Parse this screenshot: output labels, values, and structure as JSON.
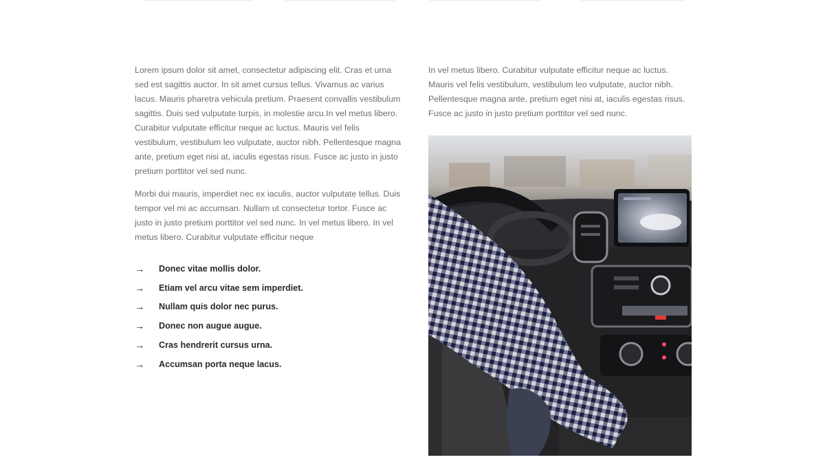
{
  "content": {
    "left": {
      "paragraphs": [
        "Lorem ipsum dolor sit amet, consectetur adipiscing elit. Cras et urna sed est sagittis auctor. In sit amet cursus tellus. Vivamus ac varius lacus. Mauris pharetra vehicula pretium. Praesent convallis vestibulum sagittis. Duis sed vulputate turpis, in molestie arcu.In vel metus libero. Curabitur vulputate efficitur neque ac luctus. Mauris vel felis vestibulum, vestibulum leo vulputate, auctor nibh. Pellentesque magna ante, pretium eget nisi at, iaculis egestas risus. Fusce ac justo in justo pretium porttitor vel sed nunc.",
        "Morbi dui mauris, imperdiet nec ex iaculis, auctor vulputate tellus. Duis tempor vel mi ac accumsan. Nullam ut consectetur tortor. Fusce ac justo in justo pretium porttitor vel sed nunc. In vel metus libero. In vel metus libero. Curabitur vulputate efficitur neque"
      ],
      "list_icon": "arrow-right-icon",
      "list_arrow": "→",
      "list": [
        "Donec vitae mollis dolor.",
        "Etiam vel arcu vitae sem imperdiet.",
        "Nullam quis dolor nec purus.",
        "Donec non augue augue.",
        "Cras hendrerit cursus urna.",
        "Accumsan porta neque lacus."
      ]
    },
    "right": {
      "paragraph": "In vel metus libero. Curabitur vulputate efficitur neque ac luctus. Mauris vel felis vestibulum, vestibulum leo vulputate, auctor nibh. Pellentesque magna ante, pretium eget nisi at, iaculis egestas risus. Fusce ac justo in justo pretium porttitor vel sed nunc.",
      "image": "car-interior-photo"
    }
  },
  "colors": {
    "body_text": "#6d6d6d",
    "list_text": "#2a2a2a",
    "background": "#ffffff"
  }
}
